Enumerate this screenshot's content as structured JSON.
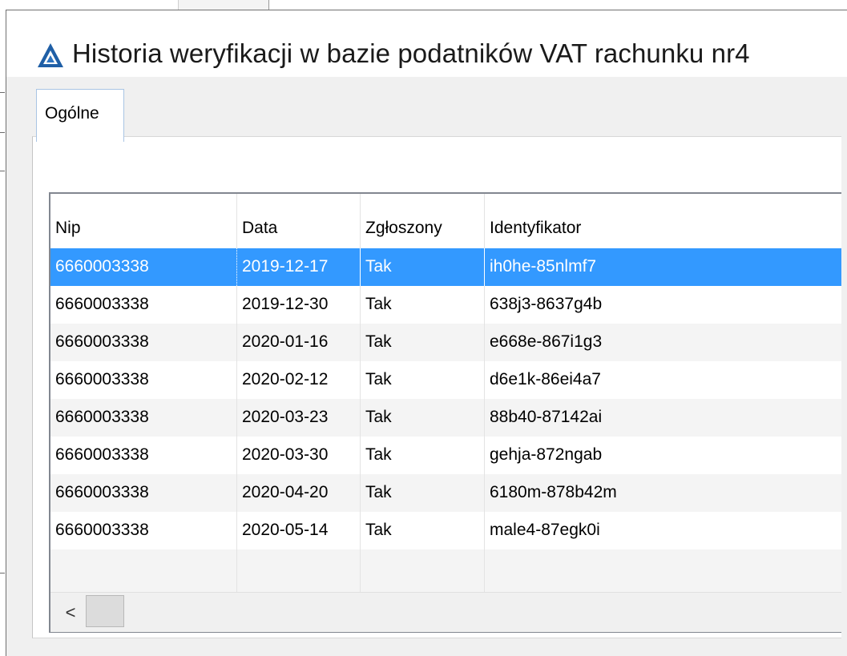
{
  "window": {
    "title": "Historia weryfikacji w bazie podatników VAT rachunku nr4"
  },
  "tabs": [
    {
      "label": "Ogólne",
      "active": true
    }
  ],
  "grid": {
    "columns": [
      "Nip",
      "Data",
      "Zgłoszony",
      "Identyfikator"
    ],
    "rows": [
      {
        "nip": "6660003338",
        "data": "2019-12-17",
        "zgloszony": "Tak",
        "identyfikator": "ih0he-85nlmf7",
        "selected": true
      },
      {
        "nip": "6660003338",
        "data": "2019-12-30",
        "zgloszony": "Tak",
        "identyfikator": "638j3-8637g4b"
      },
      {
        "nip": "6660003338",
        "data": "2020-01-16",
        "zgloszony": "Tak",
        "identyfikator": "e668e-867i1g3"
      },
      {
        "nip": "6660003338",
        "data": "2020-02-12",
        "zgloszony": "Tak",
        "identyfikator": "d6e1k-86ei4a7"
      },
      {
        "nip": "6660003338",
        "data": "2020-03-23",
        "zgloszony": "Tak",
        "identyfikator": "88b40-87142ai"
      },
      {
        "nip": "6660003338",
        "data": "2020-03-30",
        "zgloszony": "Tak",
        "identyfikator": "gehja-872ngab"
      },
      {
        "nip": "6660003338",
        "data": "2020-04-20",
        "zgloszony": "Tak",
        "identyfikator": "6180m-878b42m"
      },
      {
        "nip": "6660003338",
        "data": "2020-05-14",
        "zgloszony": "Tak",
        "identyfikator": "male4-87egk0i"
      }
    ]
  },
  "scrollbar": {
    "left_arrow": "<"
  },
  "colors": {
    "selection": "#3399ff",
    "title_icon": "#1f5fa6",
    "tab_border": "#a9c4e4"
  },
  "icons": {
    "title": "app-logo-icon",
    "scroll_left": "chevron-left-icon"
  }
}
